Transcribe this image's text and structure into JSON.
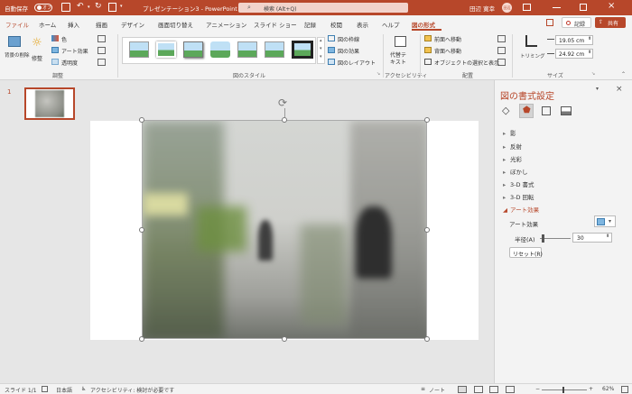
{
  "titlebar": {
    "autosave_label": "自動保存",
    "autosave_state": "オフ",
    "document_title": "プレゼンテーション3 - PowerPoint",
    "search_placeholder": "検索 (Alt+Q)",
    "user_name": "田辺 寛幸",
    "user_initials": "田辺"
  },
  "tabs": [
    "ファイル",
    "ホーム",
    "挿入",
    "描画",
    "デザイン",
    "画面切り替え",
    "アニメーション",
    "スライド ショー",
    "記録",
    "校閲",
    "表示",
    "ヘルプ",
    "図の形式"
  ],
  "tab_buttons": {
    "record": "記録",
    "share": "共有"
  },
  "ribbon": {
    "remove_bg": "背景の削除",
    "corrections": "修整",
    "color": "色",
    "art_effects": "アート効果",
    "transparency": "透明度",
    "adjust_group": "調整",
    "styles_group": "図のスタイル",
    "picture_border": "図の枠線",
    "picture_effects": "図の効果",
    "picture_layout": "図のレイアウト",
    "alt_text_line1": "代替テ",
    "alt_text_line2": "キスト",
    "accessibility_group": "アクセシビリティ",
    "bring_forward": "前面へ移動",
    "send_backward": "背面へ移動",
    "selection_pane": "オブジェクトの選択と表示",
    "arrange_group": "配置",
    "crop": "トリミング",
    "height": "19.05 cm",
    "width": "24.92 cm",
    "size_group": "サイズ"
  },
  "thumbnail": {
    "slide_number": "1"
  },
  "pane": {
    "title": "図の書式設定",
    "sections": [
      "影",
      "反射",
      "光彩",
      "ぼかし",
      "3-D 書式",
      "3-D 回転",
      "アート効果"
    ],
    "art_effect_label": "アート効果",
    "radius_label": "半径(A)",
    "radius_value": "30",
    "reset_label": "リセット(R)"
  },
  "status": {
    "slide": "スライド 1/1",
    "language": "日本語",
    "accessibility": "アクセシビリティ: 検討が必要です",
    "notes": "ノート",
    "zoom": "62%"
  },
  "colors": {
    "accent": "#b7472a",
    "selected_tab": "#b7472a"
  }
}
